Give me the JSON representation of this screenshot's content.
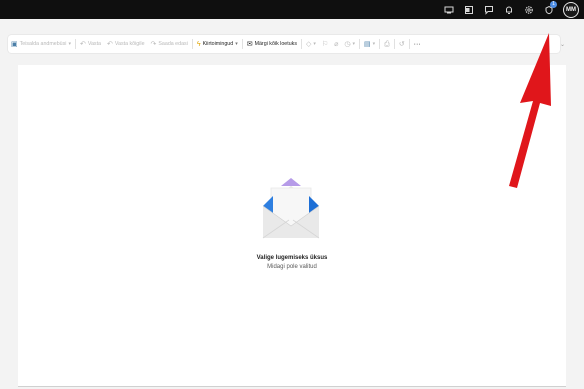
{
  "topbar": {
    "icons": [
      "present-icon",
      "word-icon",
      "chat-icon",
      "bell-icon",
      "settings-icon",
      "premium-icon"
    ],
    "badge": "1",
    "avatar_initials": "MM"
  },
  "ribbon": {
    "items": [
      {
        "label": "Teisalda andmebüsi",
        "icon": "folder-move-icon",
        "enabled": false,
        "dropdown": true
      },
      {
        "label": "Vasta",
        "icon": "reply-icon",
        "enabled": false
      },
      {
        "label": "Vasta kõigile",
        "icon": "reply-all-icon",
        "enabled": false
      },
      {
        "label": "Saada edasi",
        "icon": "forward-icon",
        "enabled": false
      },
      {
        "label": "Kiirtoimingud",
        "icon": "quick-steps-icon",
        "enabled": true,
        "dropdown": true
      },
      {
        "label": "Märgi kõik loetuks",
        "icon": "mark-read-icon",
        "enabled": true
      }
    ],
    "icon_buttons": [
      "tag-icon",
      "flag-icon",
      "pin-icon",
      "clock-icon",
      "view-icon",
      "print-icon",
      "undo-icon",
      "more-icon"
    ]
  },
  "reading_pane": {
    "title": "Valige lugemiseks üksus",
    "subtitle": "Midagi pole valitud"
  },
  "colors": {
    "topbar": "#0f0f0f",
    "accent": "#4f8fe6",
    "arrow": "#e0161b"
  }
}
